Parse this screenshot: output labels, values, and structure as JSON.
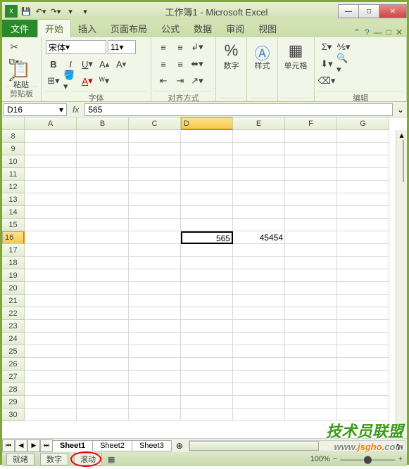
{
  "titlebar": {
    "title": "工作簿1 - Microsoft Excel"
  },
  "qat": {
    "items": [
      "excel",
      "save",
      "undo",
      "redo",
      "dd1",
      "dd2"
    ]
  },
  "win": {
    "min": "—",
    "max": "□",
    "close": "✕"
  },
  "tabs": {
    "file": "文件",
    "items": [
      "开始",
      "插入",
      "页面布局",
      "公式",
      "数据",
      "审阅",
      "视图"
    ],
    "active_index": 0
  },
  "ribbon": {
    "clipboard": {
      "label": "剪贴板",
      "paste": "粘贴"
    },
    "font": {
      "label": "字体",
      "name": "宋体",
      "size": "11"
    },
    "align": {
      "label": "对齐方式"
    },
    "number": {
      "label": "数字",
      "btn": "%"
    },
    "styles": {
      "label": "样式"
    },
    "cells": {
      "label": "单元格"
    },
    "editing": {
      "label": "编辑"
    }
  },
  "formula": {
    "namebox": "D16",
    "fx": "fx",
    "value": "565"
  },
  "grid": {
    "columns": [
      "A",
      "B",
      "C",
      "D",
      "E",
      "F",
      "G"
    ],
    "active_col": "D",
    "active_row": "16",
    "rows": [
      "8",
      "9",
      "10",
      "11",
      "12",
      "13",
      "14",
      "15",
      "16",
      "17",
      "18",
      "19",
      "20",
      "21",
      "22",
      "23",
      "24",
      "25",
      "26",
      "27",
      "28",
      "29",
      "30"
    ],
    "cells": {
      "D16": "565",
      "E16": "45454"
    }
  },
  "sheets": {
    "tabs": [
      "Sheet1",
      "Sheet2",
      "Sheet3"
    ],
    "active_index": 0
  },
  "status": {
    "ready": "就绪",
    "num": "数字",
    "scroll": "滚动",
    "zoom": "100%"
  },
  "watermark": {
    "title": "技术员联盟",
    "url_pre": "www.",
    "url_mid": "jsgho",
    "url_suf": ".com"
  }
}
